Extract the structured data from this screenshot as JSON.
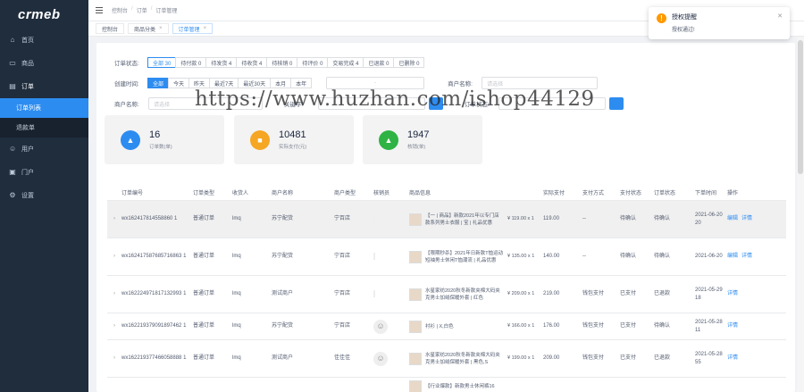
{
  "sidebar": {
    "logo": "crmeb",
    "items": [
      {
        "label": "首页",
        "icon": "home-icon"
      },
      {
        "label": "商品",
        "icon": "shop-icon"
      },
      {
        "label": "订单",
        "icon": "order-icon"
      },
      {
        "label": "用户",
        "icon": "user-icon"
      },
      {
        "label": "门户",
        "icon": "portal-icon"
      },
      {
        "label": "设置",
        "icon": "gear-icon"
      }
    ],
    "submenu": [
      {
        "label": "订单列表"
      },
      {
        "label": "退款单"
      }
    ]
  },
  "header": {
    "breadcrumb": [
      "控制台",
      "订单",
      "订单管理"
    ]
  },
  "tabs": [
    {
      "label": "控制台"
    },
    {
      "label": "商品分类"
    },
    {
      "label": "订单管理"
    }
  ],
  "filters": {
    "status_label": "订单状态:",
    "status_options": [
      "全部 30",
      "待付款 0",
      "待发货 4",
      "待收货 4",
      "待核销 0",
      "待评价 0",
      "交易完成 4",
      "已退款 0",
      "已删除 0"
    ],
    "time_label": "创建时间:",
    "time_options": [
      "全部",
      "今天",
      "昨天",
      "最近7天",
      "最近30天",
      "本月",
      "本年"
    ],
    "date_placeholder": "-",
    "shop_label": "商户名称:",
    "shop_placeholder": "请选择",
    "shop_name_label": "商户名称:",
    "shop_name_placeholder": "请选择",
    "search_label": "关键字:",
    "more_label": "订单状态:"
  },
  "stats": [
    {
      "value": "16",
      "label": "订单数(单)",
      "color": "#2d8cf0"
    },
    {
      "value": "10481",
      "label": "实际支付(元)",
      "color": "#f5a623"
    },
    {
      "value": "1947",
      "label": "核销(单)",
      "color": "#2fb344"
    }
  ],
  "table": {
    "headers": [
      "订单编号",
      "订单类型",
      "收货人",
      "商户名称",
      "商户类型",
      "核销员",
      "商品信息",
      "实际支付",
      "支付方式",
      "支付状态",
      "订单状态",
      "下单时间",
      "操作"
    ],
    "rows": [
      {
        "no": "wx162417814558860 1",
        "type": "普通订单",
        "user": "lmq",
        "shop": "苏宁配货",
        "staff": "宁百店",
        "goods": "【一 | 商品】新款2021年以专门店款系列男士衣服 | 宝 | 礼品优惠",
        "price": "¥ 119.00 x 1",
        "pay": "119.00",
        "paytype": "--",
        "paystat": "待确认",
        "ostat": "待确认",
        "time": "2021-06-20 20",
        "actions": [
          "编辑",
          "详情"
        ],
        "hl": true
      },
      {
        "no": "wx162417587685716863 1",
        "type": "普通订单",
        "user": "lmq",
        "shop": "苏宁配货",
        "staff": "宁百店",
        "goods": "【限期秒杀】2021年日新款T恤运动短袖男士休闲T恤潮流 | 礼品优惠",
        "price": "¥ 135.00 x 1",
        "pay": "140.00",
        "paytype": "--",
        "paystat": "待确认",
        "ostat": "待确认",
        "time": "2021-06-20",
        "actions": [
          "编辑",
          "详情"
        ],
        "hl": false
      },
      {
        "no": "wx162224971817132993 1",
        "type": "普通订单",
        "user": "lmq",
        "shop": "测试商户",
        "staff": "宁百店",
        "goods": "水星家纺2020秋冬新款夹棉大码夹克男士加绒保暖外套 | 红色",
        "price": "¥ 209.00 x 1",
        "pay": "219.00",
        "paytype": "钱包支付",
        "paystat": "已支付",
        "ostat": "已退款",
        "time": "2021-05-29 18",
        "actions": [
          "详情"
        ],
        "hl": false
      },
      {
        "no": "wx162219379091897462 1",
        "type": "普通订单",
        "user": "lmq",
        "shop": "苏宁配货",
        "staff": "宁百店",
        "goods": "衬衫 | X,白色",
        "price": "¥ 166.00 x 1",
        "pay": "176.00",
        "paytype": "钱包支付",
        "paystat": "已支付",
        "ostat": "待确认",
        "time": "2021-05-28 11",
        "actions": [
          "详情"
        ],
        "hl": false
      },
      {
        "no": "wx162219377466058888 1",
        "type": "普通订单",
        "user": "lmq",
        "shop": "测试商户",
        "staff": "佳佳佳",
        "goods": "水星家纺2020秋冬新款夹棉大码夹克男士加绒保暖外套 | 黑色,S",
        "price": "¥ 199.00 x 1",
        "pay": "209.00",
        "paytype": "钱包支付",
        "paystat": "已支付",
        "ostat": "已退款",
        "time": "2021-05-28 55",
        "actions": [
          "详情"
        ],
        "hl": false
      },
      {
        "no": "",
        "type": "",
        "user": "",
        "shop": "",
        "staff": "",
        "goods": "【行业爆款】新款男士休闲裤16",
        "price": "",
        "pay": "",
        "paytype": "",
        "paystat": "",
        "ostat": "",
        "time": "",
        "actions": [],
        "hl": false
      }
    ]
  },
  "notice": {
    "title": "授权提醒",
    "desc": "授权通过!"
  },
  "watermark": "https://www.huzhan.com/ishop44129"
}
